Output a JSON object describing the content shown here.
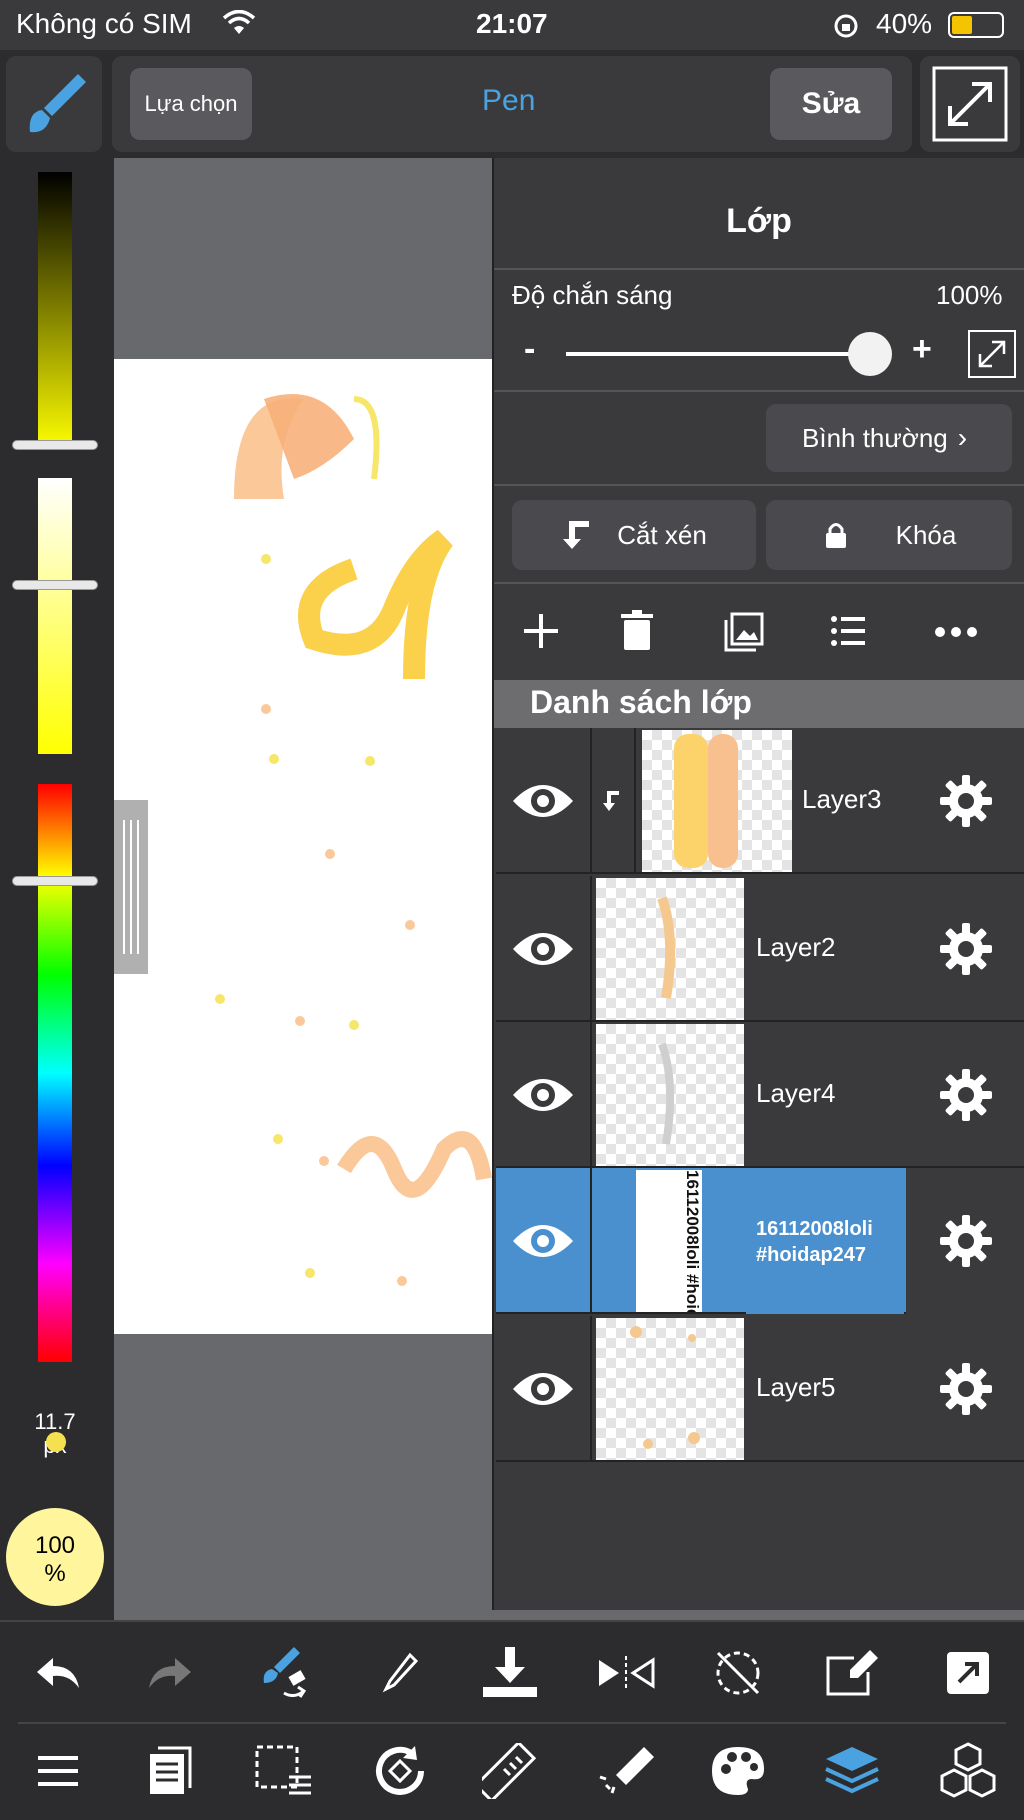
{
  "status_bar": {
    "carrier": "Không có SIM",
    "time": "21:07",
    "battery": "40%"
  },
  "top_bar": {
    "select_label": "Lựa chọn",
    "tool_name": "Pen",
    "edit_label": "Sửa"
  },
  "brush": {
    "size": "11.7",
    "unit": "px",
    "opacity": "100",
    "opacity_unit": "%"
  },
  "layer_panel": {
    "title": "Lớp",
    "opacity_label": "Độ chắn sáng",
    "opacity_value": "100%",
    "opacity_level": 1.0,
    "minus": "-",
    "plus": "+",
    "blend_mode": "Bình thường",
    "clip_label": "Cắt xén",
    "lock_label": "Khóa",
    "list_header": "Danh sách lớp",
    "layers": [
      {
        "name": "Layer3",
        "clipped": true
      },
      {
        "name": "Layer2"
      },
      {
        "name": "Layer4"
      },
      {
        "name": "16112008loli\n#hoidap247",
        "selected": true
      },
      {
        "name": "Layer5"
      }
    ],
    "selected_thumb_text": "16112008loli #hoidap247"
  },
  "colors": {
    "accent": "#4a90cf",
    "panel": "#3a3a3c",
    "bar": "#2c2c2e",
    "opacity_circle": "#fff59d"
  }
}
